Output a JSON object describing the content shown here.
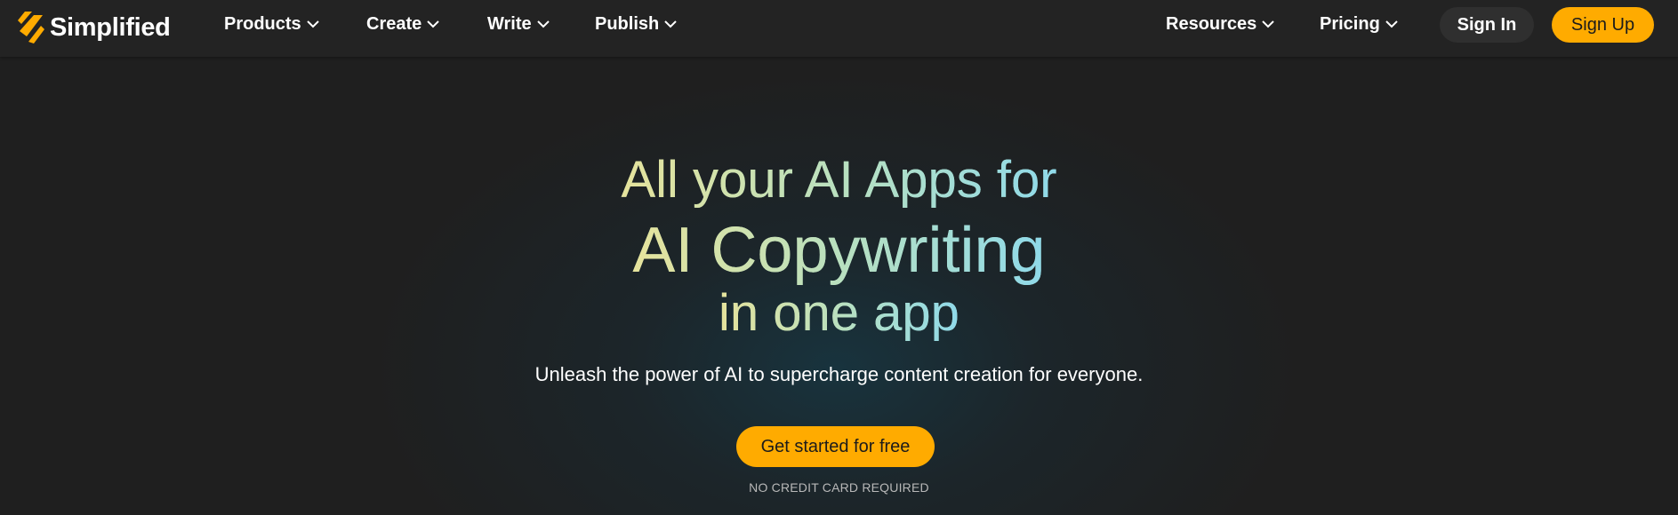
{
  "brand": {
    "name": "Simplified",
    "logo_icon": "simplified-logo-icon",
    "accent_color": "#ffab00"
  },
  "nav": {
    "items": [
      {
        "label": "Products",
        "icon": "chevron-down-icon"
      },
      {
        "label": "Create",
        "icon": "chevron-down-icon"
      },
      {
        "label": "Write",
        "icon": "chevron-down-icon"
      },
      {
        "label": "Publish",
        "icon": "chevron-down-icon"
      },
      {
        "label": "Resources",
        "icon": "chevron-down-icon"
      },
      {
        "label": "Pricing",
        "icon": "chevron-down-icon"
      }
    ],
    "sign_in_label": "Sign In",
    "sign_up_label": "Sign Up"
  },
  "hero": {
    "headline_line1": "All your AI Apps for",
    "headline_line2": "AI Copywriting",
    "headline_line3": "in one app",
    "subtitle": "Unleash the power of AI to supercharge content creation for everyone.",
    "cta_label": "Get started for free",
    "note": "NO CREDIT CARD REQUIRED",
    "gradient_colors": [
      "#e6e39c",
      "#b9e0bf",
      "#8fdaea"
    ]
  }
}
